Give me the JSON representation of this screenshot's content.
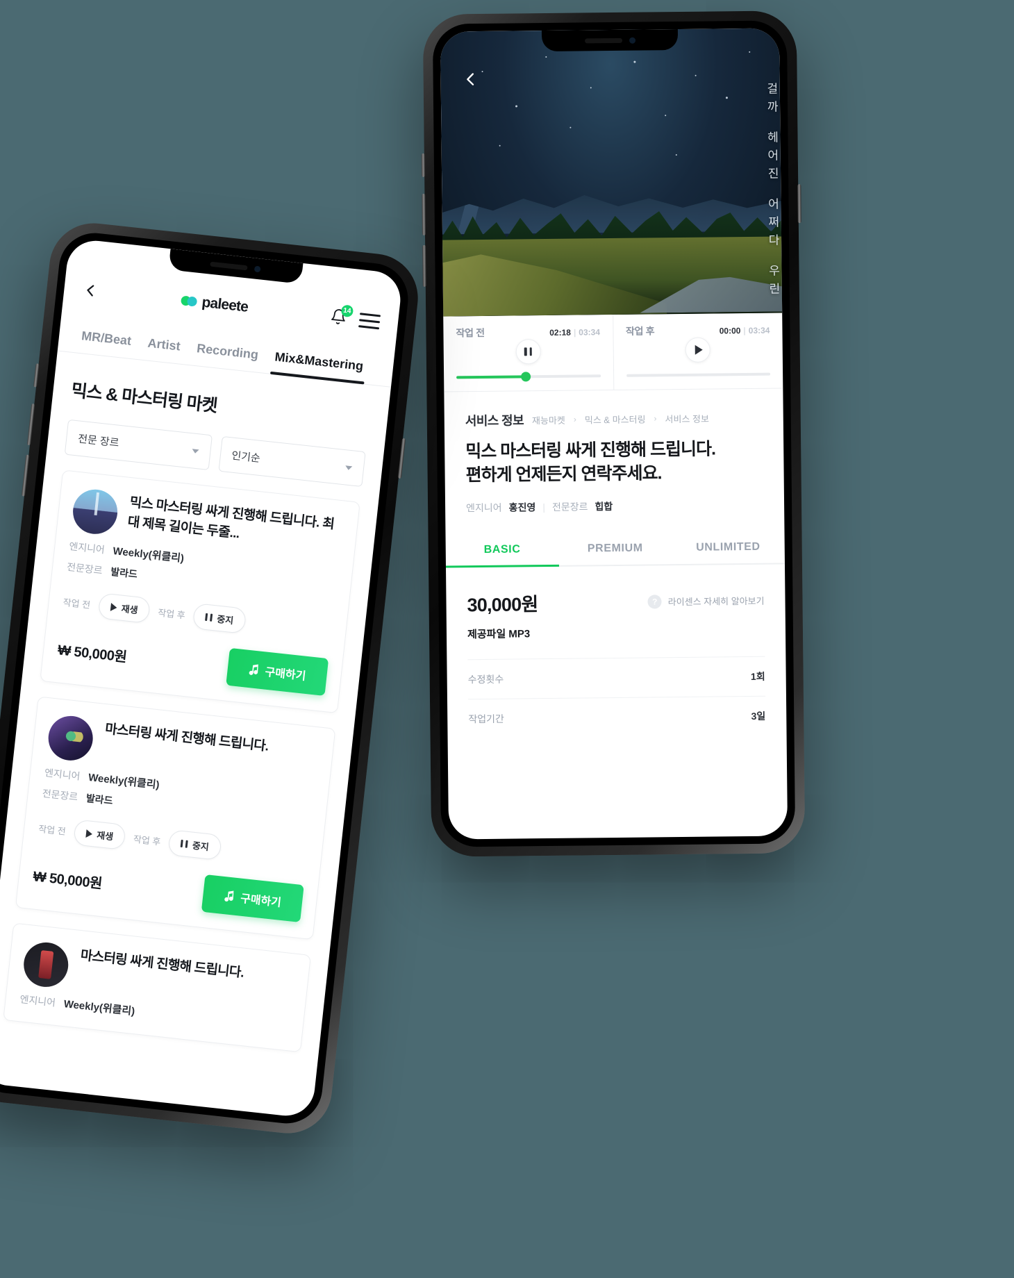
{
  "colors": {
    "accent": "#18cf63",
    "bg": "#4b6a72",
    "dark": "#15181d",
    "muted": "#a5acb7"
  },
  "right_phone": {
    "hero": {
      "back_icon": "chevron-left-icon",
      "vertical_lines": [
        "우린",
        "어쩌다",
        "헤어진",
        "걸까"
      ]
    },
    "players": [
      {
        "label": "작업 전",
        "current": "02:18",
        "sep": "|",
        "duration": "03:34",
        "state": "pause",
        "progress": 48
      },
      {
        "label": "작업 후",
        "current": "00:00",
        "sep": "|",
        "duration": "03:34",
        "state": "play",
        "progress": 0
      }
    ],
    "breadcrumb": {
      "current": "서비스 정보",
      "trail": [
        "재능마켓",
        "믹스 & 마스터링",
        "서비스 정보"
      ],
      "separator": "›"
    },
    "title": "믹스 마스터링 싸게 진행해 드립니다.\n편하게 언제든지 연락주세요.",
    "meta": {
      "engineer_label": "엔지니어",
      "engineer_value": "홍진영",
      "divider": "|",
      "genre_label": "전문장르",
      "genre_value": "힙합"
    },
    "tabs": [
      {
        "label": "BASIC",
        "active": true
      },
      {
        "label": "PREMIUM",
        "active": false
      },
      {
        "label": "UNLIMITED",
        "active": false
      }
    ],
    "price": "30,000원",
    "license": {
      "icon": "question-mark-icon",
      "label": "라이센스 자세히 알아보기"
    },
    "file": "제공파일 MP3",
    "specs": [
      {
        "key": "수정횟수",
        "value": "1회"
      },
      {
        "key": "작업기간",
        "value": "3일"
      }
    ]
  },
  "left_phone": {
    "header": {
      "back_icon": "chevron-left-icon",
      "logo_text": "paleete",
      "bell_icon": "bell-icon",
      "bell_badge": "14",
      "menu_icon": "hamburger-menu-icon"
    },
    "tabs": [
      {
        "label": "MR/Beat",
        "active": false
      },
      {
        "label": "Artist",
        "active": false
      },
      {
        "label": "Recording",
        "active": false
      },
      {
        "label": "Mix&Mastering",
        "active": true
      }
    ],
    "page_title": "믹스 & 마스터링 마켓",
    "filters": [
      {
        "value": "전문 장르",
        "icon": "chevron-down-icon"
      },
      {
        "value": "인기순",
        "icon": "chevron-down-icon"
      }
    ],
    "labels": {
      "engineer": "엔지니어",
      "genre": "전문장르",
      "before": "작업 전",
      "after": "작업 후",
      "play": "재생",
      "pause": "중지",
      "buy": "구매하기",
      "buy_icon": "music-note-icon"
    },
    "cards": [
      {
        "thumb": "t1",
        "title": "믹스 마스터링 싸게 진행해 드립니다. 최대 제목 길이는 두줄...",
        "engineer": "Weekly(위클리)",
        "genre": "발라드",
        "price": "₩ 50,000원"
      },
      {
        "thumb": "t2",
        "title": "마스터링 싸게 진행해 드립니다.",
        "engineer": "Weekly(위클리)",
        "genre": "발라드",
        "price": "₩ 50,000원"
      },
      {
        "thumb": "t3",
        "title": "마스터링 싸게 진행해 드립니다.",
        "engineer": "Weekly(위클리)",
        "genre": "",
        "price": ""
      }
    ]
  }
}
